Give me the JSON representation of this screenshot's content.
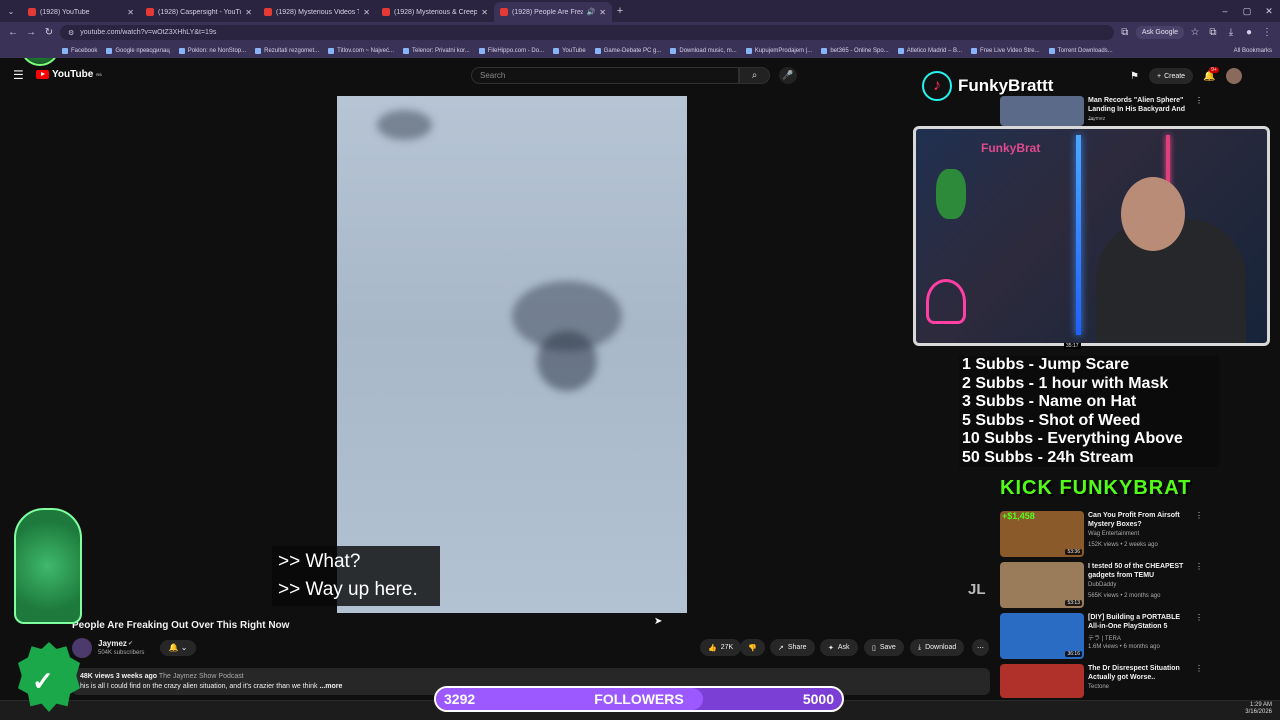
{
  "browser": {
    "tabs": [
      {
        "label": "(1928) YouTube",
        "active": false
      },
      {
        "label": "(1928) Caspersight - YouTube",
        "active": false
      },
      {
        "label": "(1928) Mysterious Videos That",
        "active": false
      },
      {
        "label": "(1928) Mysterious & Creepy Ti",
        "active": false
      },
      {
        "label": "(1928) People Are Freaking",
        "active": true
      }
    ],
    "url": "youtube.com/watch?v=wOtZ3XHhLY&t=19s",
    "ask_google": "Ask Google",
    "all_bookmarks": "All Bookmarks",
    "bookmarks": [
      "Facebook",
      "Google преводилац",
      "Poklon: ne NonStop...",
      "Rezultati rezgomet...",
      "Titlov.com ~ Najveć...",
      "Telenor: Privatni kor...",
      "FileHippo.com - Do...",
      "YouTube",
      "Game-Debate PC g...",
      "Download music, m...",
      "KupujemProdajem |...",
      "bet365 - Online Spo...",
      "Atletico Madrid – B...",
      "Free Live Video Stre...",
      "Torrent Downloads..."
    ]
  },
  "youtube": {
    "logo_text": "YouTube",
    "logo_superscript": "RS",
    "search_placeholder": "Search",
    "create_label": "Create",
    "notifications_badge": "9+",
    "video": {
      "subtitle_line1": ">> What?",
      "subtitle_line2": ">> Way up here.",
      "watermark": "JL",
      "title": "People Are Freaking Out Over This Right Now"
    },
    "channel": {
      "name": "Jaymez",
      "subscribers": "504K subscribers"
    },
    "actions": {
      "likes": "27K",
      "share": "Share",
      "ask": "Ask",
      "save": "Save",
      "download": "Download"
    },
    "description": {
      "views": "48K views",
      "age": "3 weeks ago",
      "tag": "The Jaymez Show Podcast",
      "text": "his is all I could find on the crazy alien situation, and it's crazier than we think",
      "more": "...more"
    },
    "top_recommendation": {
      "title": "Man Records \"Alien Sphere\" Landing In His Backyard And ...",
      "channel": "Jaymez"
    },
    "recommendations": [
      {
        "title": "Can You Profit From Airsoft Mystery Boxes?",
        "channel": "Wag Entertainment",
        "meta": "152K views • 2 weeks ago",
        "duration": "53:36",
        "color": "#8a5a2b"
      },
      {
        "title": "I tested 50 of the CHEAPEST gadgets from TEMU",
        "channel": "DubDaddy",
        "meta": "565K views • 2 months ago",
        "duration": "53:13",
        "color": "#9a7b5a"
      },
      {
        "title": "[DIY] Building a PORTABLE All-in-One PlayStation 5",
        "channel": "テラ | TERA",
        "meta": "1.6M views • 6 months ago",
        "duration": "36:16",
        "color": "#2a6cc4"
      },
      {
        "title": "The Dr Disrespect Situation Actually got Worse..",
        "channel": "Tectone",
        "meta": "",
        "duration": "",
        "color": "#b0302a"
      }
    ]
  },
  "overlays": {
    "tiktok_name": "FunkyBrattt",
    "cam_sign": "FunkyBrat",
    "cam_timer": "35:17",
    "sub_goals": [
      "1 Subbs - Jump Scare",
      "2 Subbs - 1 hour with Mask",
      "3 Subbs - Name on Hat",
      "5 Subbs - Shot of Weed",
      "10 Subbs - Everything Above",
      "50 Subbs - 24h Stream"
    ],
    "kick_name": "KICK FUNKYBRAT",
    "money_badge": "+$1,458",
    "followers": {
      "current": "3292",
      "label": "FOLLOWERS",
      "goal": "5000",
      "progress": 0.6584
    }
  },
  "taskbar": {
    "time": "1:29 AM",
    "date": "3/16/2026"
  },
  "colors": {
    "accent": "#7b3fd6",
    "kick_green": "#53fc18",
    "youtube_red": "#ff0000"
  }
}
